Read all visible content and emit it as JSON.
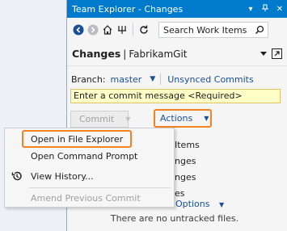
{
  "window": {
    "title": "Team Explorer - Changes",
    "controls": {
      "dropdown": "▾",
      "pin": "⊞",
      "close": "✕"
    }
  },
  "toolbar": {
    "search_placeholder": "Search Work Items",
    "icons": [
      "back-icon",
      "forward-icon",
      "home-icon",
      "connect-icon",
      "refresh-icon",
      "search-icon"
    ]
  },
  "header": {
    "title": "Changes",
    "separator": "|",
    "repo": "FabrikamGit"
  },
  "branch": {
    "label": "Branch:",
    "value": "master",
    "unsynced_link": "Unsynced Commits"
  },
  "commit": {
    "message_placeholder": "Enter a commit message <Required>",
    "commit_button": "Commit",
    "actions_button": "Actions"
  },
  "background_fragments": {
    "row1": "Items",
    "row2": "nges",
    "row3": "nges",
    "row4": "es",
    "options": "Options"
  },
  "status": {
    "empty_untracked": "There are no untracked files."
  },
  "context_menu": {
    "items": [
      {
        "label": "Open in File Explorer",
        "enabled": true
      },
      {
        "label": "Open Command Prompt",
        "enabled": true
      },
      {
        "label": "View History...",
        "enabled": true,
        "icon": "history-icon"
      },
      {
        "label": "Amend Previous Commit",
        "enabled": false
      }
    ]
  },
  "colors": {
    "titlebar": "#007acc",
    "highlight": "#f58220",
    "link": "#1a4e97",
    "commit_input_bg": "#ffffc8"
  }
}
